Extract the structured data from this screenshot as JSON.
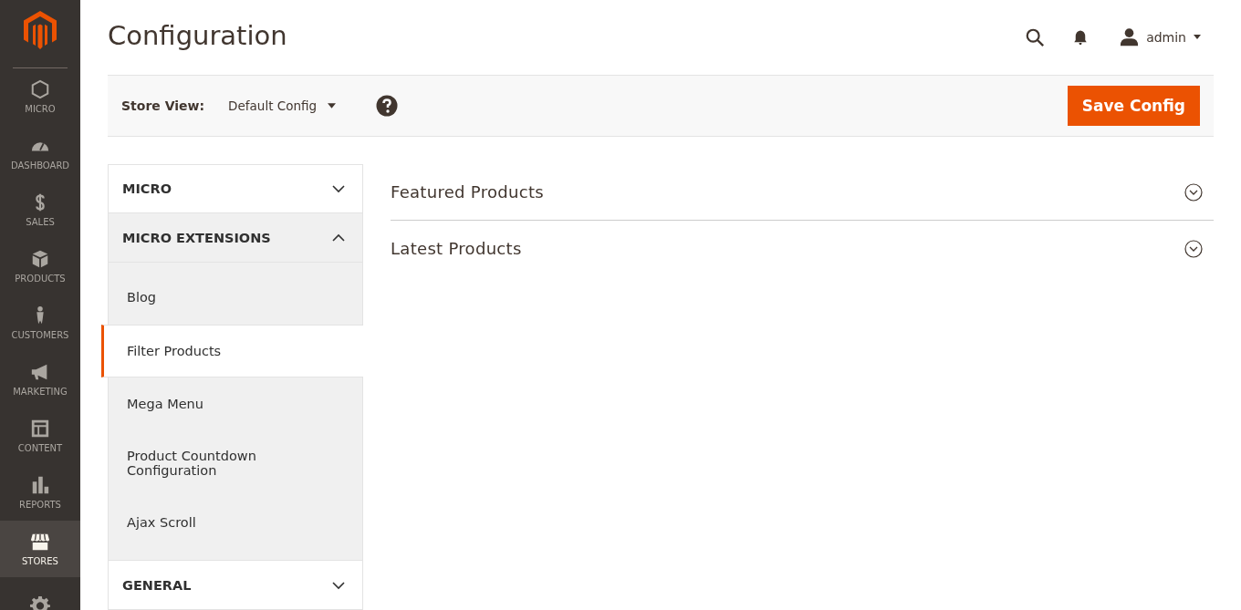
{
  "nav": [
    {
      "kind": "micro",
      "label": "MICRO",
      "selected": false
    },
    {
      "kind": "dashboard",
      "label": "DASHBOARD",
      "selected": false
    },
    {
      "kind": "sales",
      "label": "SALES",
      "selected": false
    },
    {
      "kind": "products",
      "label": "PRODUCTS",
      "selected": false
    },
    {
      "kind": "customers",
      "label": "CUSTOMERS",
      "selected": false
    },
    {
      "kind": "marketing",
      "label": "MARKETING",
      "selected": false
    },
    {
      "kind": "content",
      "label": "CONTENT",
      "selected": false
    },
    {
      "kind": "reports",
      "label": "REPORTS",
      "selected": false
    },
    {
      "kind": "stores",
      "label": "STORES",
      "selected": true
    },
    {
      "kind": "system",
      "selected": false
    }
  ],
  "page_title": "Configuration",
  "user": {
    "name": "admin"
  },
  "toolbar": {
    "store_view_label": "Store View:",
    "store_view_value": "Default Config",
    "save_button": "Save Config"
  },
  "config_tabs": [
    {
      "title": "MICRO",
      "expanded": false
    },
    {
      "title": "MICRO EXTENSIONS",
      "expanded": true,
      "items": [
        {
          "label": "Blog",
          "selected": false
        },
        {
          "label": "Filter Products",
          "selected": true
        },
        {
          "label": "Mega Menu",
          "selected": false
        },
        {
          "label": "Product Countdown Configuration",
          "selected": false
        },
        {
          "label": "Ajax Scroll",
          "selected": false
        }
      ]
    },
    {
      "title": "GENERAL",
      "expanded": false
    }
  ],
  "sections": [
    {
      "title": "Featured Products",
      "expanded": false
    },
    {
      "title": "Latest Products",
      "expanded": false
    }
  ]
}
